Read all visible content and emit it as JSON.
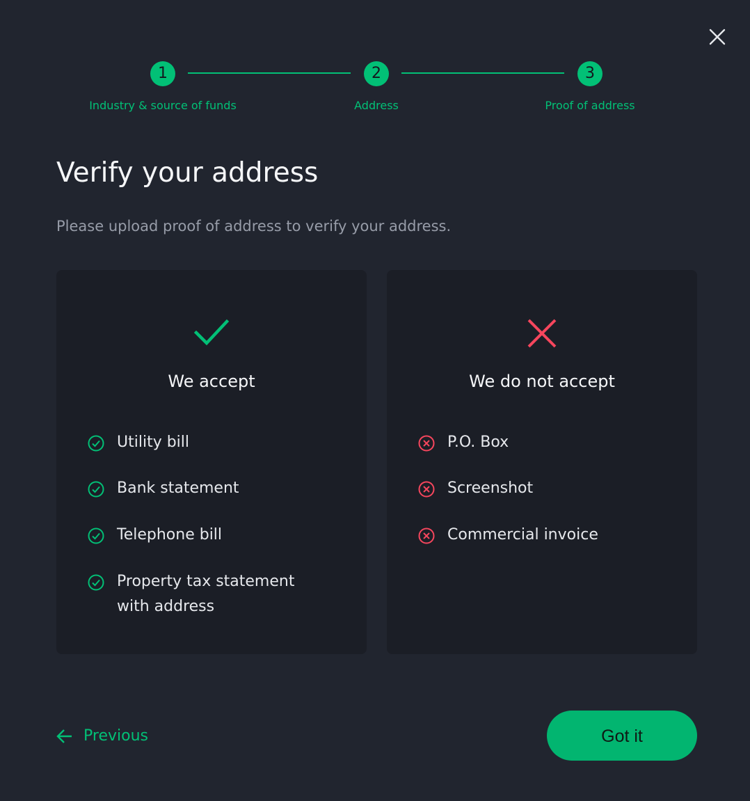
{
  "stepper": {
    "steps": [
      {
        "number": "1",
        "label": "Industry & source of funds"
      },
      {
        "number": "2",
        "label": "Address"
      },
      {
        "number": "3",
        "label": "Proof of address"
      }
    ]
  },
  "header": {
    "title": "Verify your address",
    "subtitle": "Please upload proof of address to verify your address."
  },
  "accept_card": {
    "title": "We accept",
    "icon": "checkmark-icon",
    "items": [
      {
        "label": "Utility bill"
      },
      {
        "label": "Bank statement"
      },
      {
        "label": "Telephone bill"
      },
      {
        "label": "Property tax statement with address"
      }
    ]
  },
  "reject_card": {
    "title": "We do not accept",
    "icon": "cross-icon",
    "items": [
      {
        "label": "P.O. Box"
      },
      {
        "label": "Screenshot"
      },
      {
        "label": "Commercial invoice"
      }
    ]
  },
  "footer": {
    "previous_label": "Previous",
    "confirm_label": "Got it"
  },
  "colors": {
    "accent": "#02c076",
    "error": "#f6465d",
    "background": "#21252f",
    "card": "#1b1e26"
  }
}
